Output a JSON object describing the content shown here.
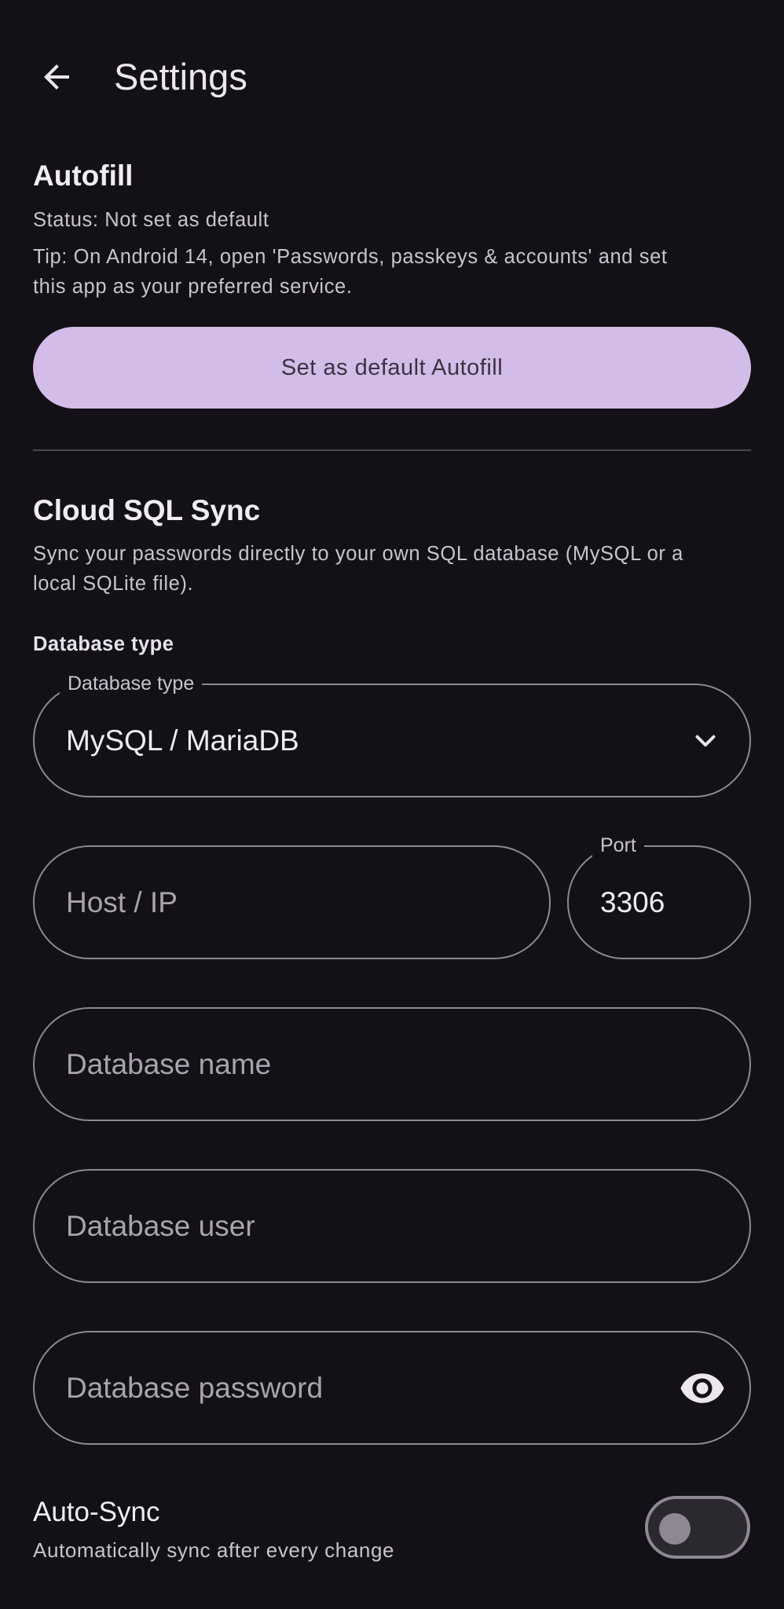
{
  "header": {
    "title": "Settings",
    "back_icon": "arrow-back-icon"
  },
  "autofill": {
    "title": "Autofill",
    "status": "Status: Not set as default",
    "tip_line1": "Tip: On Android 14, open 'Passwords, passkeys & accounts' and set",
    "tip_line2": "this app as your preferred service.",
    "button_label": "Set as default Autofill"
  },
  "cloud_sync": {
    "title": "Cloud SQL Sync",
    "desc_line1": "Sync your passwords directly to your own SQL database (MySQL or a",
    "desc_line2": "local SQLite file).",
    "db_type_caption": "Database type",
    "db_type_field": {
      "label": "Database type",
      "value": "MySQL / MariaDB",
      "icon": "chevron-down-icon"
    },
    "host_field": {
      "placeholder": "Host / IP"
    },
    "port_field": {
      "label": "Port",
      "value": "3306"
    },
    "db_name_field": {
      "placeholder": "Database name"
    },
    "db_user_field": {
      "placeholder": "Database user"
    },
    "db_password_field": {
      "placeholder": "Database password",
      "icon": "eye-icon"
    },
    "auto_sync": {
      "title": "Auto-Sync",
      "subtitle": "Automatically sync after every change",
      "enabled": false
    }
  },
  "colors": {
    "background": "#131117",
    "primary_button": "#d3bde8",
    "outline": "#8e8893",
    "text_primary": "#f1ecf4",
    "text_secondary": "#c9c3cd"
  }
}
